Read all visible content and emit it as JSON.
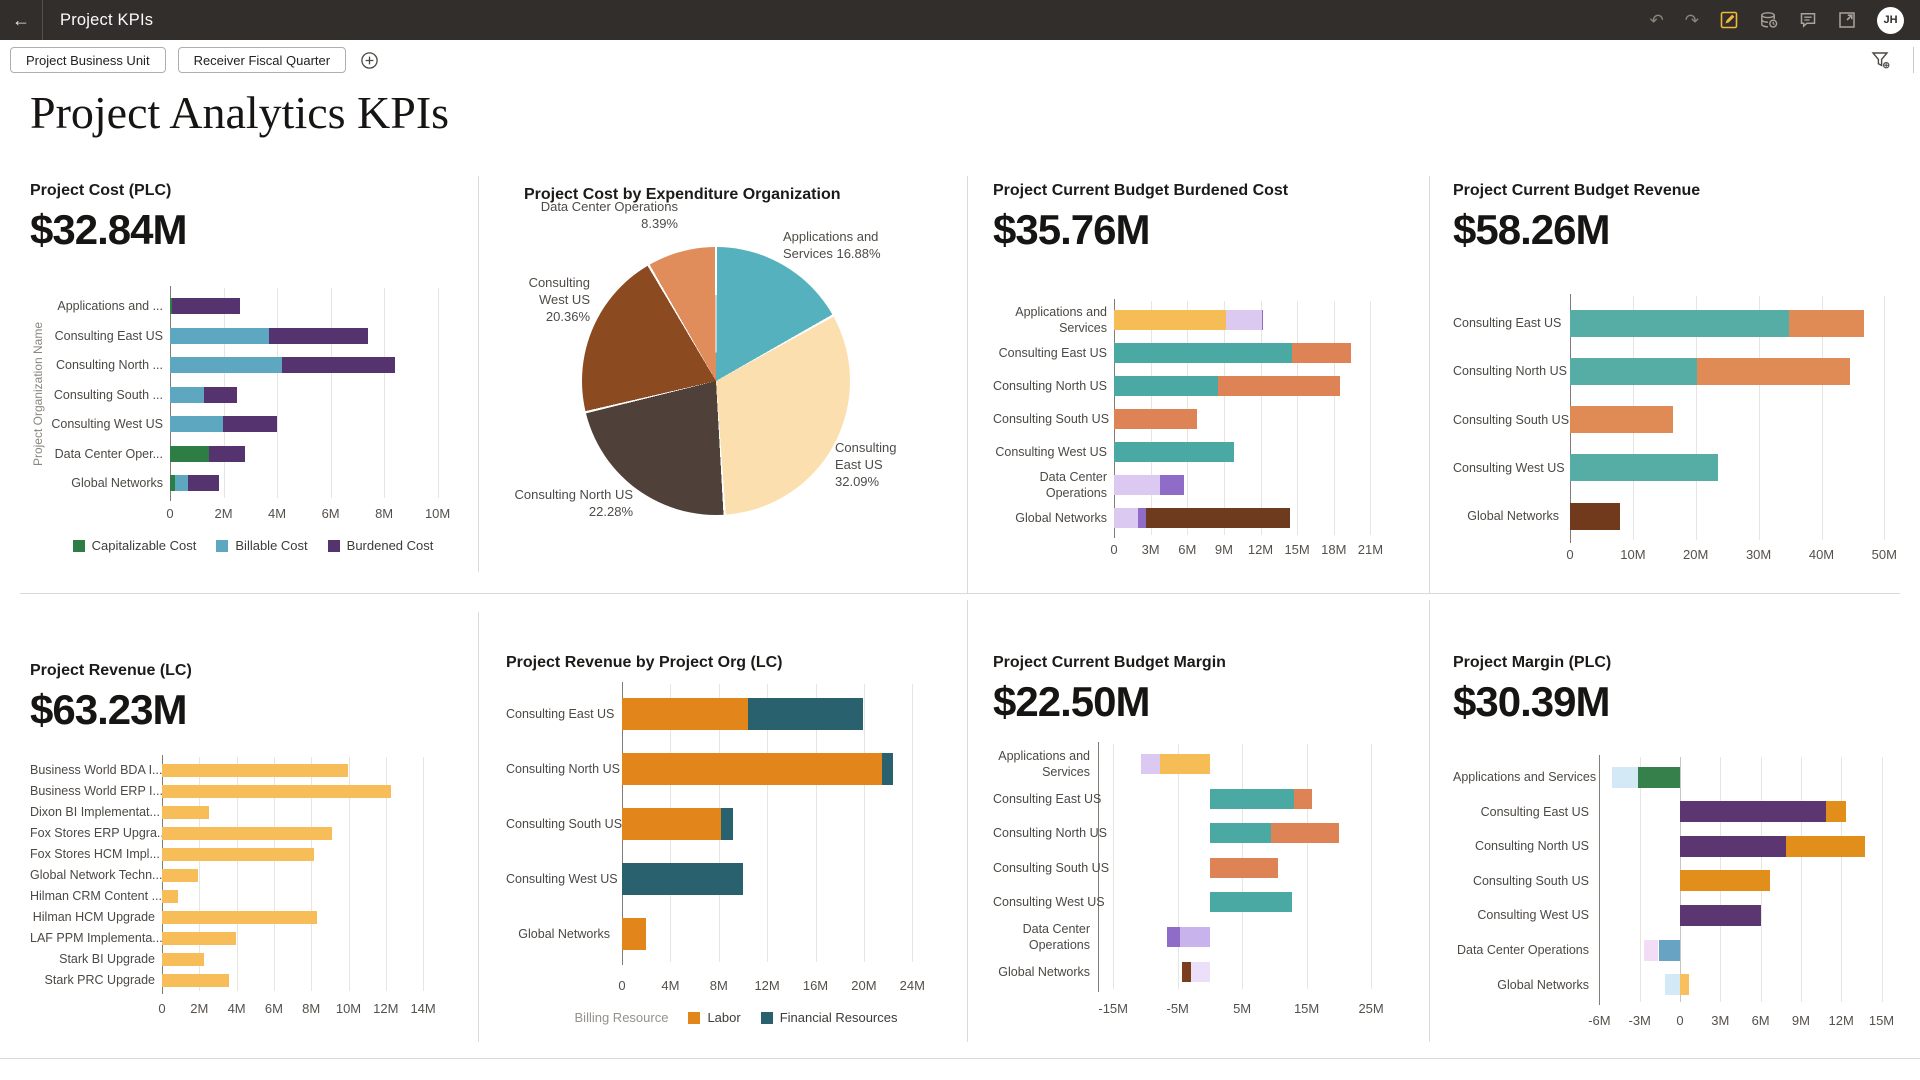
{
  "header": {
    "title": "Project KPIs",
    "back_icon": "←",
    "undo_icon": "↶",
    "redo_icon": "↷",
    "avatar": "JH",
    "icon_names": [
      "undo-icon",
      "redo-icon",
      "edit-icon",
      "refresh-data-icon",
      "comments-icon",
      "open-in-new-icon"
    ],
    "edit_icon_color": "#efb73e"
  },
  "filter_bar": {
    "chips": [
      "Project Business Unit",
      "Receiver Fiscal Quarter"
    ]
  },
  "page_title": "Project Analytics KPIs",
  "panels": [
    {
      "id": "cost-plc",
      "type": "bar",
      "title": "Project Cost (PLC)",
      "kpi": "$32.84M",
      "y_axis_title": "Project Organization Name",
      "axis": {
        "min": 0,
        "max": 10,
        "ticks": [
          {
            "v": 0,
            "label": "0"
          },
          {
            "v": 2,
            "label": "2M"
          },
          {
            "v": 4,
            "label": "4M"
          },
          {
            "v": 6,
            "label": "6M"
          },
          {
            "v": 8,
            "label": "8M"
          },
          {
            "v": 10,
            "label": "10M"
          }
        ]
      },
      "legend": {
        "items": [
          {
            "label": "Capitalizable Cost",
            "color": "#2E7D44"
          },
          {
            "label": "Billable Cost",
            "color": "#5EA7C0"
          },
          {
            "label": "Burdened Cost",
            "color": "#54336E"
          }
        ]
      },
      "rows": [
        {
          "label": "Applications and ...",
          "pos": [
            {
              "v": 0.07,
              "c": "#2E7D44"
            },
            {
              "v": 2.55,
              "c": "#54336E"
            }
          ]
        },
        {
          "label": "Consulting East US",
          "pos": [
            {
              "v": 3.68,
              "c": "#5EA7C0"
            },
            {
              "v": 3.7,
              "c": "#54336E"
            }
          ]
        },
        {
          "label": "Consulting North ...",
          "pos": [
            {
              "v": 4.18,
              "c": "#5EA7C0"
            },
            {
              "v": 4.22,
              "c": "#54336E"
            }
          ]
        },
        {
          "label": "Consulting South ...",
          "pos": [
            {
              "v": 1.26,
              "c": "#5EA7C0"
            },
            {
              "v": 1.26,
              "c": "#54336E"
            }
          ]
        },
        {
          "label": "Consulting West US",
          "pos": [
            {
              "v": 1.98,
              "c": "#5EA7C0"
            },
            {
              "v": 2.03,
              "c": "#54336E"
            }
          ]
        },
        {
          "label": "Data Center Oper...",
          "pos": [
            {
              "v": 1.44,
              "c": "#2E7D44"
            },
            {
              "v": 1.38,
              "c": "#54336E"
            }
          ]
        },
        {
          "label": "Global Networks",
          "pos": [
            {
              "v": 0.18,
              "c": "#2E7D44"
            },
            {
              "v": 0.5,
              "c": "#5EA7C0"
            },
            {
              "v": 1.17,
              "c": "#54336E"
            }
          ]
        }
      ]
    },
    {
      "id": "cost-by-expenditure-org",
      "type": "pie",
      "title": "Project Cost by Expenditure Organization",
      "slices": [
        {
          "name": "Applications and Services",
          "pct": 16.88,
          "color": "#54B1BD",
          "label_text": "Applications and\nServices 16.88%"
        },
        {
          "name": "Consulting East US",
          "pct": 32.09,
          "color": "#FBDFAF",
          "label_text": "Consulting\nEast US\n32.09%"
        },
        {
          "name": "Consulting North US",
          "pct": 22.28,
          "color": "#4F4139",
          "label_text": "Consulting North US\n22.28%"
        },
        {
          "name": "Consulting West US",
          "pct": 20.36,
          "color": "#8C4A21",
          "label_text": "Consulting\nWest US\n20.36%"
        },
        {
          "name": "Data Center Operations",
          "pct": 8.39,
          "color": "#E18D5B",
          "label_text": "Data Center Operations\n8.39%"
        }
      ]
    },
    {
      "id": "budget-burdened-cost",
      "type": "bar",
      "title": "Project Current Budget Burdened Cost",
      "kpi": "$35.76M",
      "axis": {
        "min": 0,
        "max": 21,
        "ticks": [
          {
            "v": 0,
            "label": "0"
          },
          {
            "v": 3,
            "label": "3M"
          },
          {
            "v": 6,
            "label": "6M"
          },
          {
            "v": 9,
            "label": "9M"
          },
          {
            "v": 12,
            "label": "12M"
          },
          {
            "v": 15,
            "label": "15M"
          },
          {
            "v": 18,
            "label": "18M"
          },
          {
            "v": 21,
            "label": "21M"
          }
        ]
      },
      "rows": [
        {
          "label": "Applications and\nServices",
          "pos": [
            {
              "v": 9.2,
              "c": "#F6BC55"
            },
            {
              "v": 2.9,
              "c": "#DCC9F2"
            },
            {
              "v": 0.15,
              "c": "#8F6CC7"
            }
          ]
        },
        {
          "label": "Consulting East US",
          "pos": [
            {
              "v": 14.6,
              "c": "#4AA9A2"
            },
            {
              "v": 4.8,
              "c": "#DE8355"
            }
          ]
        },
        {
          "label": "Consulting North US",
          "pos": [
            {
              "v": 8.5,
              "c": "#4AA9A2"
            },
            {
              "v": 10.0,
              "c": "#DE8355"
            }
          ]
        },
        {
          "label": "Consulting South US",
          "pos": [
            {
              "v": 6.8,
              "c": "#DE8355"
            }
          ]
        },
        {
          "label": "Consulting West US",
          "pos": [
            {
              "v": 9.8,
              "c": "#4AA9A2"
            }
          ]
        },
        {
          "label": "Data Center\nOperations",
          "pos": [
            {
              "v": 3.8,
              "c": "#DCC9F2"
            },
            {
              "v": 1.9,
              "c": "#8F6CC7"
            }
          ]
        },
        {
          "label": "Global Networks",
          "pos": [
            {
              "v": 2.0,
              "c": "#DCC9F2"
            },
            {
              "v": 0.6,
              "c": "#8F6CC7"
            },
            {
              "v": 11.8,
              "c": "#6E3B1F"
            }
          ]
        }
      ]
    },
    {
      "id": "budget-revenue",
      "type": "bar",
      "title": "Project Current Budget Revenue",
      "kpi": "$58.26M",
      "axis": {
        "min": 0,
        "max": 50,
        "ticks": [
          {
            "v": 0,
            "label": "0"
          },
          {
            "v": 10,
            "label": "10M"
          },
          {
            "v": 20,
            "label": "20M"
          },
          {
            "v": 30,
            "label": "30M"
          },
          {
            "v": 40,
            "label": "40M"
          },
          {
            "v": 50,
            "label": "50M"
          }
        ]
      },
      "rows": [
        {
          "label": "Consulting East US",
          "pos": [
            {
              "v": 34.9,
              "c": "#55ADA5"
            },
            {
              "v": 11.8,
              "c": "#E08A55"
            }
          ]
        },
        {
          "label": "Consulting North US",
          "pos": [
            {
              "v": 20.2,
              "c": "#55ADA5"
            },
            {
              "v": 24.3,
              "c": "#E08A55"
            }
          ]
        },
        {
          "label": "Consulting South US",
          "pos": [
            {
              "v": 16.3,
              "c": "#E08A55"
            }
          ]
        },
        {
          "label": "Consulting West US",
          "pos": [
            {
              "v": 23.6,
              "c": "#55ADA5"
            }
          ]
        },
        {
          "label": "Global Networks",
          "pos": [
            {
              "v": 8.0,
              "c": "#713A1D"
            }
          ]
        }
      ]
    },
    {
      "id": "revenue-lc",
      "type": "bar",
      "title": "Project Revenue (LC)",
      "kpi": "$63.23M",
      "axis": {
        "min": 0,
        "max": 14,
        "ticks": [
          {
            "v": 0,
            "label": "0"
          },
          {
            "v": 2,
            "label": "2M"
          },
          {
            "v": 4,
            "label": "4M"
          },
          {
            "v": 6,
            "label": "6M"
          },
          {
            "v": 8,
            "label": "8M"
          },
          {
            "v": 10,
            "label": "10M"
          },
          {
            "v": 12,
            "label": "12M"
          },
          {
            "v": 14,
            "label": "14M"
          }
        ]
      },
      "rows": [
        {
          "label": "Business World BDA I...",
          "pos": [
            {
              "v": 9.95,
              "c": "#F7BD58"
            }
          ]
        },
        {
          "label": "Business World ERP I...",
          "pos": [
            {
              "v": 12.26,
              "c": "#F7BD58"
            }
          ]
        },
        {
          "label": "Dixon BI Implementat...",
          "pos": [
            {
              "v": 2.52,
              "c": "#F7BD58"
            }
          ]
        },
        {
          "label": "Fox Stores ERP Upgra...",
          "pos": [
            {
              "v": 9.1,
              "c": "#F7BD58"
            }
          ]
        },
        {
          "label": "Fox Stores HCM Impl...",
          "pos": [
            {
              "v": 8.15,
              "c": "#F7BD58"
            }
          ]
        },
        {
          "label": "Global Network Techn...",
          "pos": [
            {
              "v": 1.95,
              "c": "#F7BD58"
            }
          ]
        },
        {
          "label": "Hilman CRM Content ...",
          "pos": [
            {
              "v": 0.86,
              "c": "#F7BD58"
            }
          ]
        },
        {
          "label": "Hilman HCM Upgrade",
          "pos": [
            {
              "v": 8.3,
              "c": "#F7BD58"
            }
          ]
        },
        {
          "label": "LAF PPM Implementa...",
          "pos": [
            {
              "v": 3.98,
              "c": "#F7BD58"
            }
          ]
        },
        {
          "label": "Stark BI Upgrade",
          "pos": [
            {
              "v": 2.27,
              "c": "#F7BD58"
            }
          ]
        },
        {
          "label": "Stark PRC Upgrade",
          "pos": [
            {
              "v": 3.57,
              "c": "#F7BD58"
            }
          ]
        }
      ]
    },
    {
      "id": "revenue-by-project-org",
      "type": "bar",
      "title": "Project Revenue by Project Org (LC)",
      "axis": {
        "min": 0,
        "max": 24,
        "ticks": [
          {
            "v": 0,
            "label": "0"
          },
          {
            "v": 4,
            "label": "4M"
          },
          {
            "v": 8,
            "label": "8M"
          },
          {
            "v": 12,
            "label": "12M"
          },
          {
            "v": 16,
            "label": "16M"
          },
          {
            "v": 20,
            "label": "20M"
          },
          {
            "v": 24,
            "label": "24M"
          }
        ]
      },
      "legend": {
        "prefix": "Billing Resource",
        "items": [
          {
            "label": "Labor",
            "color": "#E2861B"
          },
          {
            "label": "Financial Resources",
            "color": "#2A616E"
          }
        ]
      },
      "rows": [
        {
          "label": "Consulting East US",
          "pos": [
            {
              "v": 10.45,
              "c": "#E2861B"
            },
            {
              "v": 9.45,
              "c": "#2A616E"
            }
          ]
        },
        {
          "label": "Consulting North US",
          "pos": [
            {
              "v": 21.5,
              "c": "#E2861B"
            },
            {
              "v": 0.9,
              "c": "#2A616E"
            }
          ]
        },
        {
          "label": "Consulting South US",
          "pos": [
            {
              "v": 8.2,
              "c": "#E2861B"
            },
            {
              "v": 1.0,
              "c": "#2A616E"
            }
          ]
        },
        {
          "label": "Consulting West US",
          "pos": [
            {
              "v": 10.0,
              "c": "#2A616E"
            }
          ]
        },
        {
          "label": "Global Networks",
          "pos": [
            {
              "v": 2.0,
              "c": "#E2861B"
            }
          ]
        }
      ]
    },
    {
      "id": "budget-margin",
      "type": "bar",
      "title": "Project Current Budget Margin",
      "kpi": "$22.50M",
      "axis": {
        "min": -15,
        "max": 25,
        "ticks": [
          {
            "v": -15,
            "label": "-15M"
          },
          {
            "v": -5,
            "label": "-5M"
          },
          {
            "v": 5,
            "label": "5M"
          },
          {
            "v": 15,
            "label": "15M"
          },
          {
            "v": 25,
            "label": "25M"
          }
        ]
      },
      "rows": [
        {
          "label": "Applications and\nServices",
          "neg": [
            {
              "v": 7.8,
              "c": "#F6BC55"
            },
            {
              "v": 2.9,
              "c": "#DCC9F2"
            }
          ]
        },
        {
          "label": "Consulting East US",
          "pos": [
            {
              "v": 13.0,
              "c": "#4AA9A2"
            },
            {
              "v": 2.9,
              "c": "#DE8355"
            }
          ]
        },
        {
          "label": "Consulting North US",
          "pos": [
            {
              "v": 9.5,
              "c": "#4AA9A2"
            },
            {
              "v": 10.6,
              "c": "#DE8355"
            }
          ]
        },
        {
          "label": "Consulting South US",
          "pos": [
            {
              "v": 10.5,
              "c": "#DE8355"
            }
          ]
        },
        {
          "label": "Consulting West US",
          "pos": [
            {
              "v": 12.8,
              "c": "#4AA9A2"
            }
          ]
        },
        {
          "label": "Data Center\nOperations",
          "neg": [
            {
              "v": 4.6,
              "c": "#C9B3EC"
            },
            {
              "v": 2.0,
              "c": "#8F6CC7"
            }
          ]
        },
        {
          "label": "Global Networks",
          "neg": [
            {
              "v": 2.9,
              "c": "#EBDFFA"
            },
            {
              "v": 1.5,
              "c": "#7B3E1E"
            }
          ]
        }
      ]
    },
    {
      "id": "margin-plc",
      "type": "bar",
      "title": "Project Margin (PLC)",
      "kpi": "$30.39M",
      "axis": {
        "min": -6,
        "max": 15,
        "ticks": [
          {
            "v": -6,
            "label": "-6M"
          },
          {
            "v": -3,
            "label": "-3M"
          },
          {
            "v": 0,
            "label": "0"
          },
          {
            "v": 3,
            "label": "3M"
          },
          {
            "v": 6,
            "label": "6M"
          },
          {
            "v": 9,
            "label": "9M"
          },
          {
            "v": 12,
            "label": "12M"
          },
          {
            "v": 15,
            "label": "15M"
          }
        ]
      },
      "rows": [
        {
          "label": "Applications and Services",
          "neg": [
            {
              "v": 3.1,
              "c": "#36814B"
            },
            {
              "v": 2.0,
              "c": "#D4E9F6"
            }
          ]
        },
        {
          "label": "Consulting East US",
          "pos": [
            {
              "v": 10.9,
              "c": "#5C3671"
            },
            {
              "v": 1.5,
              "c": "#E28E1B"
            }
          ]
        },
        {
          "label": "Consulting North US",
          "pos": [
            {
              "v": 7.9,
              "c": "#5C3671"
            },
            {
              "v": 5.9,
              "c": "#E28E1B"
            }
          ]
        },
        {
          "label": "Consulting South US",
          "pos": [
            {
              "v": 6.7,
              "c": "#E28E1B"
            }
          ]
        },
        {
          "label": "Consulting West US",
          "pos": [
            {
              "v": 6.0,
              "c": "#5C3671"
            }
          ]
        },
        {
          "label": "Data Center Operations",
          "neg": [
            {
              "v": 1.6,
              "c": "#69A3C4"
            },
            {
              "v": 1.1,
              "c": "#F2DCF6"
            }
          ]
        },
        {
          "label": "Global Networks",
          "neg": [
            {
              "v": 1.1,
              "c": "#D4E9F6"
            }
          ],
          "pos": [
            {
              "v": 0.7,
              "c": "#F8C05C"
            }
          ]
        }
      ]
    }
  ]
}
